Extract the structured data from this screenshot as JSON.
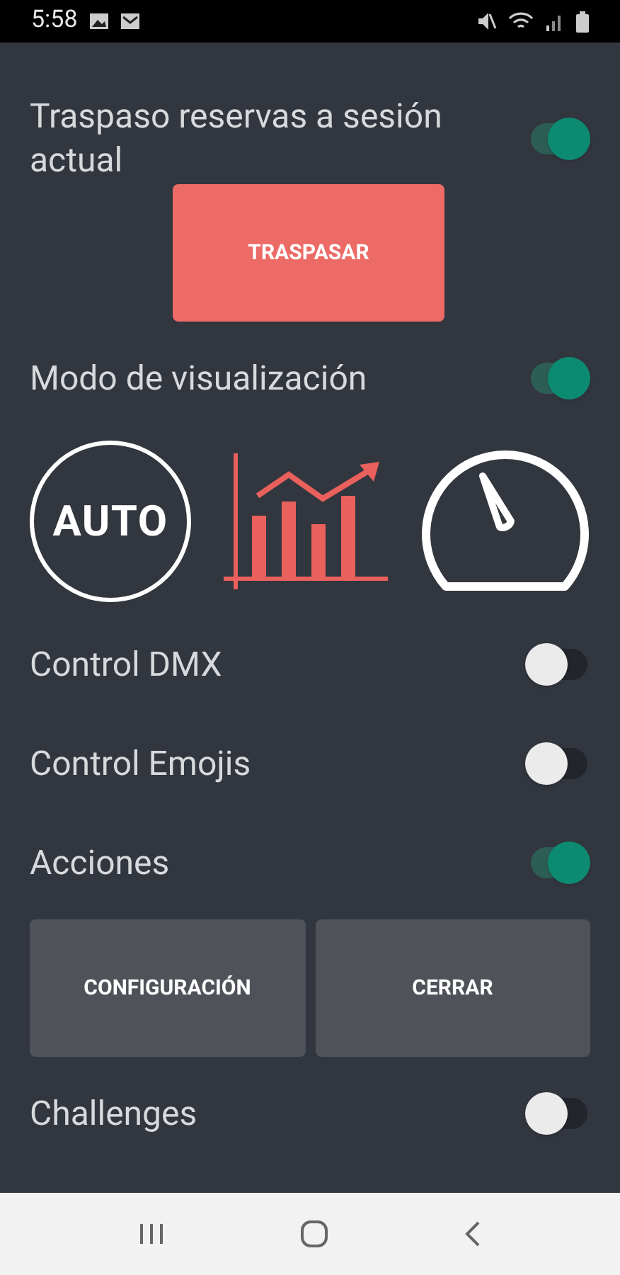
{
  "status_bar": {
    "time": "5:58"
  },
  "settings": [
    {
      "kind": "toggle",
      "label": "Traspaso reservas a sesión actual",
      "on": true
    },
    {
      "kind": "button",
      "label": "TRASPASAR"
    },
    {
      "kind": "toggle",
      "label": "Modo de visualización",
      "on": true
    },
    {
      "kind": "modes",
      "modes": [
        {
          "kind": "auto",
          "text": "AUTO",
          "selected": false
        },
        {
          "kind": "chart",
          "selected": true
        },
        {
          "kind": "gauge",
          "selected": false
        }
      ]
    },
    {
      "kind": "toggle",
      "label": "Control DMX",
      "on": false
    },
    {
      "kind": "toggle",
      "label": "Control Emojis",
      "on": false
    },
    {
      "kind": "toggle",
      "label": "Acciones",
      "on": true
    },
    {
      "kind": "buttons",
      "buttons": [
        "CONFIGURACIÓN",
        "CERRAR"
      ]
    },
    {
      "kind": "toggle",
      "label": "Challenges",
      "on": false
    }
  ]
}
